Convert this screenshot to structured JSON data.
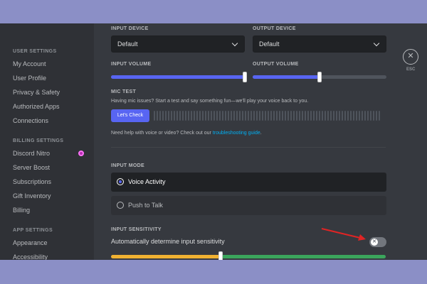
{
  "sidebar": {
    "user_settings_header": "USER SETTINGS",
    "user_settings": [
      "My Account",
      "User Profile",
      "Privacy & Safety",
      "Authorized Apps",
      "Connections"
    ],
    "billing_settings_header": "BILLING SETTINGS",
    "billing_settings": [
      "Discord Nitro",
      "Server Boost",
      "Subscriptions",
      "Gift Inventory",
      "Billing"
    ],
    "app_settings_header": "APP SETTINGS",
    "app_settings": [
      "Appearance",
      "Accessibility"
    ]
  },
  "voice": {
    "input_device_label": "INPUT DEVICE",
    "input_device_value": "Default",
    "output_device_label": "OUTPUT DEVICE",
    "output_device_value": "Default",
    "input_volume_label": "INPUT VOLUME",
    "input_volume": 1.0,
    "output_volume_label": "OUTPUT VOLUME",
    "output_volume": 0.5,
    "mic_test_label": "MIC TEST",
    "mic_test_desc": "Having mic issues? Start a test and say something fun—we'll play your voice back to you.",
    "lets_check_button": "Let's Check",
    "help_prefix": "Need help with voice or video? Check out our ",
    "help_link": "troubleshooting guide",
    "help_suffix": ".",
    "input_mode_label": "INPUT MODE",
    "voice_activity_label": "Voice Activity",
    "push_to_talk_label": "Push to Talk",
    "input_sensitivity_label": "INPUT SENSITIVITY",
    "auto_sensitivity_label": "Automatically determine input sensitivity",
    "auto_sensitivity_enabled": false,
    "sensitivity_level": 0.4
  },
  "close": {
    "esc_label": "ESC"
  },
  "colors": {
    "accent": "#5865f2",
    "sensitivity_low": "#f0b232",
    "sensitivity_high": "#3ba55c",
    "annotation_arrow": "#e02424"
  }
}
